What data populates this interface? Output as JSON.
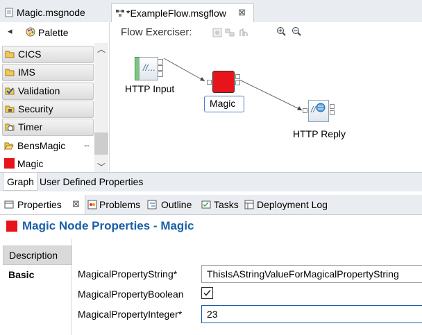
{
  "editor_tabs": {
    "node_tab": "Magic.msgnode",
    "flow_tab": "*ExampleFlow.msgflow",
    "flow_close": "⊠"
  },
  "palette": {
    "title": "Palette",
    "drawers": [
      "CICS",
      "IMS",
      "Validation",
      "Security",
      "Timer"
    ],
    "open_drawer": "BensMagic",
    "open_drawer_mark": "⇔",
    "item": "Magic"
  },
  "canvas": {
    "toolbar_label": "Flow Exerciser:",
    "nodes": {
      "http_input": "HTTP Input",
      "magic": "Magic",
      "http_reply": "HTTP Reply"
    }
  },
  "editor_bottom_tabs": [
    "Graph",
    "User Defined Properties"
  ],
  "view_tabs": {
    "properties": "Properties",
    "properties_close": "⊠",
    "problems": "Problems",
    "outline": "Outline",
    "tasks": "Tasks",
    "deployment_log": "Deployment Log"
  },
  "properties": {
    "title": "Magic Node Properties - Magic",
    "sections": [
      "Description",
      "Basic"
    ],
    "fields": {
      "string_label": "MagicalPropertyString*",
      "string_value": "ThisIsAStringValueForMagicalPropertyString",
      "boolean_label": "MagicalPropertyBoolean",
      "boolean_value": true,
      "integer_label": "MagicalPropertyInteger*",
      "integer_value": "23"
    }
  },
  "colors": {
    "accent_blue": "#1a5fa8",
    "magic_red": "#e8141c",
    "input_green": "#7ec77a"
  }
}
